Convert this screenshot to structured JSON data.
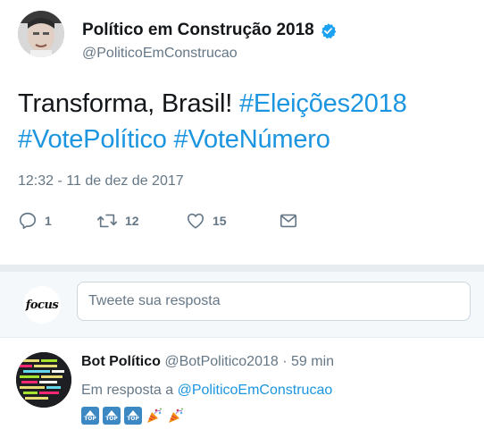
{
  "tweet": {
    "author_name": "Político em Construção 2018",
    "author_handle": "@PoliticoEmConstrucao",
    "text_plain": "Transforma, Brasil!",
    "hashtag_1": "#Eleições2018",
    "hashtag_2": "#VotePolítico",
    "hashtag_3": "#VoteNúmero",
    "timestamp": "12:32 - 11 de dez de 2017",
    "replies": "1",
    "retweets": "12",
    "likes": "15"
  },
  "reply_box": {
    "logo_text": "focus",
    "placeholder": "Tweete sua resposta"
  },
  "reply": {
    "author_name": "Bot Político",
    "author_handle": "@BotPolitico2018",
    "separator": "·",
    "time": "59 min",
    "in_reply_prefix": "Em resposta a",
    "in_reply_mention": "@PoliticoEmConstrucao",
    "emoji_top_label": "TOP",
    "emojis": [
      "top-arrow",
      "top-arrow",
      "top-arrow",
      "party-popper",
      "party-popper"
    ]
  },
  "colors": {
    "link": "#1b95e0",
    "secondary_text": "#657786",
    "primary_text": "#14171a",
    "divider": "#e6ecf0",
    "verified": "#1da1f2"
  }
}
